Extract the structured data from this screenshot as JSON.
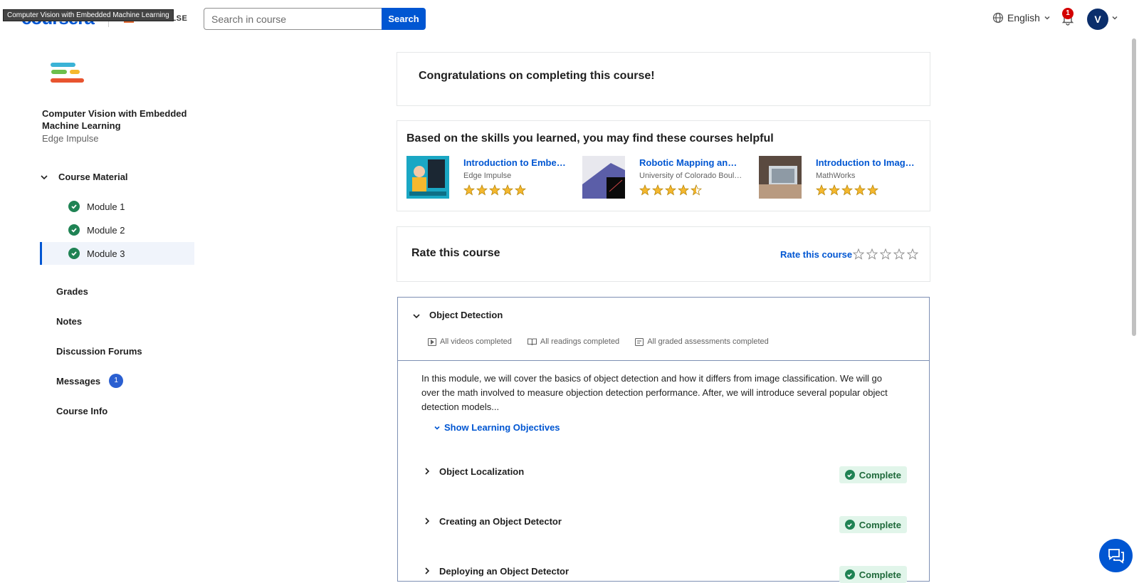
{
  "header": {
    "logo": "coursera",
    "tooltip": "Computer Vision with Embedded Machine Learning",
    "partner_text": "ULSE",
    "search_placeholder": "Search in course",
    "search_button": "Search",
    "language": "English",
    "notification_count": "1",
    "avatar_initial": "V"
  },
  "sidebar": {
    "course_title": "Computer Vision with Embedded Machine Learning",
    "course_partner": "Edge Impulse",
    "course_material_label": "Course Material",
    "modules": [
      "Module 1",
      "Module 2",
      "Module 3"
    ],
    "nav": {
      "grades": "Grades",
      "notes": "Notes",
      "forums": "Discussion Forums",
      "messages": "Messages",
      "messages_badge": "1",
      "course_info": "Course Info"
    }
  },
  "main": {
    "congrats": "Congratulations on completing this course!",
    "recommendations": {
      "title": "Based on the skills you learned, you may find these courses helpful",
      "items": [
        {
          "name": "Introduction to Embedded Machine Learning",
          "partner": "Edge Impulse",
          "rating": 5
        },
        {
          "name": "Robotic Mapping and Trajectory Generation",
          "partner": "University of Colorado Boulder",
          "rating": 4.5
        },
        {
          "name": "Introduction to Image Processing",
          "partner": "MathWorks",
          "rating": 5
        }
      ]
    },
    "rate": {
      "title": "Rate this course",
      "link": "Rate this course"
    },
    "module": {
      "title": "Object Detection",
      "stats": [
        "All videos completed",
        "All readings completed",
        "All graded assessments completed"
      ],
      "description": "In this module, we will cover the basics of object detection and how it differs from image classification. We will go over the math involved to measure objection detection performance. After, we will introduce several popular object detection models...",
      "show_objectives": "Show Learning Objectives",
      "lessons": [
        {
          "name": "Object Localization",
          "status": "Complete"
        },
        {
          "name": "Creating an Object Detector",
          "status": "Complete"
        },
        {
          "name": "Deploying an Object Detector",
          "status": "Complete"
        }
      ]
    }
  },
  "colors": {
    "brand": "#0056d2",
    "complete_bg": "#e1f5ea",
    "complete_text": "#1f6a3b",
    "check_green": "#1f8354",
    "star": "#f5b82e"
  }
}
